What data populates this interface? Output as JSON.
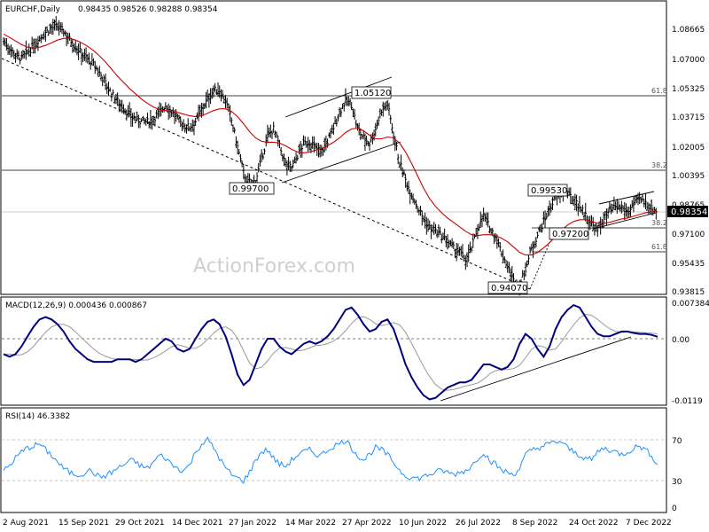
{
  "header": {
    "symbol_line": "EURCHF,Daily",
    "ohlc": "0.98435 0.98526 0.98288 0.98354"
  },
  "watermark": "ActionForex.com",
  "x_axis": {
    "labels": [
      "2 Aug 2021",
      "15 Sep 2021",
      "29 Oct 2021",
      "14 Dec 2021",
      "27 Jan 2022",
      "14 Mar 2022",
      "27 Apr 2022",
      "10 Jun 2022",
      "26 Jul 2022",
      "8 Sep 2022",
      "24 Oct 2022",
      "7 Dec 2022"
    ]
  },
  "price_panel": {
    "y_ticks": [
      "1.08665",
      "1.07000",
      "1.05325",
      "1.03715",
      "1.02005",
      "1.00395",
      "0.98765",
      "0.97100",
      "0.95435",
      "0.93815"
    ],
    "current_price_label": "0.98354",
    "fib_labels": [
      "61.8",
      "38.2",
      "38.2",
      "61.8"
    ],
    "annotations": [
      "1.05120",
      "0.99700",
      "0.99530",
      "0.97200",
      "0.94070"
    ]
  },
  "macd_panel": {
    "title": "MACD(12,26,9) 0.000436 0.000867",
    "y_ticks": [
      "0.007384",
      "0.00",
      "-0.0119"
    ]
  },
  "rsi_panel": {
    "title": "RSI(14) 46.3382",
    "y_ticks": [
      "70",
      "30",
      "0"
    ]
  },
  "colors": {
    "price_bars": "#000000",
    "moving_average": "#cc0000",
    "macd_line": "#000080",
    "signal_line": "#999999",
    "rsi_line": "#1e90ff",
    "current_price_bg": "#000000"
  },
  "chart_data": [
    {
      "type": "ohlc",
      "title": "EURCHF,Daily",
      "x_range": [
        "2 Aug 2021",
        "Dec 2022"
      ],
      "ylim": [
        0.93815,
        1.095
      ],
      "grid": false,
      "horizontal_levels": [
        1.0512,
        0.997,
        0.972,
        0.959
      ],
      "annotated_points": [
        {
          "label": "1.05120",
          "value": 1.0512,
          "date": "May 2022"
        },
        {
          "label": "0.99700",
          "value": 0.997,
          "date": "Mar 2022"
        },
        {
          "label": "0.99530",
          "value": 0.9953,
          "date": "Oct 2022"
        },
        {
          "label": "0.97200",
          "value": 0.972,
          "date": "Oct 2022"
        },
        {
          "label": "0.94070",
          "value": 0.9407,
          "date": "Sep 2022"
        }
      ],
      "close_series": [
        1.08,
        1.076,
        1.072,
        1.07,
        1.0735,
        1.0775,
        1.0815,
        1.085,
        1.0875,
        1.088,
        1.0855,
        1.081,
        1.077,
        1.073,
        1.07,
        1.0665,
        1.062,
        1.056,
        1.05,
        1.046,
        1.042,
        1.038,
        1.0355,
        1.0345,
        1.034,
        1.036,
        1.0395,
        1.0435,
        1.04,
        1.0355,
        1.032,
        1.031,
        1.0345,
        1.041,
        1.047,
        1.052,
        1.052,
        1.046,
        1.035,
        1.02,
        1.005,
        0.998,
        1.001,
        1.0125,
        1.026,
        1.03,
        1.02,
        1.01,
        1.008,
        1.015,
        1.0215,
        1.0225,
        1.019,
        1.0175,
        1.023,
        1.031,
        1.0395,
        1.046,
        1.044,
        1.03,
        1.025,
        1.022,
        1.03,
        1.041,
        1.044,
        1.027,
        1.011,
        1.001,
        0.993,
        0.986,
        0.979,
        0.974,
        0.972,
        0.969,
        0.966,
        0.962,
        0.96,
        0.956,
        0.962,
        0.974,
        0.981,
        0.974,
        0.969,
        0.96,
        0.952,
        0.944,
        0.941,
        0.951,
        0.962,
        0.97,
        0.977,
        0.985,
        0.991,
        0.994,
        0.993,
        0.99,
        0.986,
        0.981,
        0.976,
        0.972,
        0.979,
        0.983,
        0.9855,
        0.985,
        0.983,
        0.987,
        0.99,
        0.988,
        0.985,
        0.9835
      ],
      "moving_average_series": [
        1.084,
        1.082,
        1.08,
        1.078,
        1.0765,
        1.076,
        1.0765,
        1.0775,
        1.079,
        1.0805,
        1.0815,
        1.0815,
        1.0805,
        1.079,
        1.077,
        1.0745,
        1.0715,
        1.068,
        1.064,
        1.06,
        1.0565,
        1.053,
        1.05,
        1.047,
        1.0445,
        1.0425,
        1.041,
        1.0405,
        1.04,
        1.0395,
        1.0385,
        1.0375,
        1.037,
        1.0375,
        1.039,
        1.0405,
        1.0415,
        1.0415,
        1.04,
        1.037,
        1.033,
        1.0285,
        1.025,
        1.023,
        1.0225,
        1.0225,
        1.022,
        1.0205,
        1.0185,
        1.017,
        1.0165,
        1.017,
        1.018,
        1.019,
        1.0205,
        1.0225,
        1.025,
        1.028,
        1.03,
        1.0305,
        1.029,
        1.0265,
        1.0245,
        1.0245,
        1.0255,
        1.025,
        1.022,
        1.017,
        1.0105,
        1.0035,
        0.9965,
        0.9905,
        0.986,
        0.9825,
        0.9795,
        0.977,
        0.9745,
        0.972,
        0.97,
        0.9695,
        0.97,
        0.97,
        0.9695,
        0.968,
        0.966,
        0.963,
        0.96,
        0.9585,
        0.9585,
        0.96,
        0.9625,
        0.9655,
        0.969,
        0.9725,
        0.9755,
        0.9775,
        0.9785,
        0.9785,
        0.9775,
        0.9765,
        0.9765,
        0.977,
        0.978,
        0.979,
        0.9795,
        0.9805,
        0.9815,
        0.9825,
        0.983,
        0.983
      ]
    },
    {
      "type": "line",
      "title": "MACD(12,26,9) 0.000436 0.000867",
      "ylim": [
        -0.0125,
        0.008
      ],
      "series": [
        {
          "name": "MACD(12,26,9)",
          "values": [
            -0.003,
            -0.0035,
            -0.003,
            -0.0015,
            0.0005,
            0.0025,
            0.004,
            0.0045,
            0.004,
            0.003,
            0.0015,
            -0.0005,
            -0.002,
            -0.003,
            -0.004,
            -0.0045,
            -0.0045,
            -0.0045,
            -0.0045,
            -0.004,
            -0.004,
            -0.004,
            -0.0045,
            -0.004,
            -0.003,
            -0.002,
            -0.001,
            0.0,
            -0.0005,
            -0.002,
            -0.0025,
            -0.002,
            0.0,
            0.002,
            0.0035,
            0.004,
            0.003,
            0.0005,
            -0.003,
            -0.007,
            -0.009,
            -0.008,
            -0.005,
            -0.002,
            0.0,
            0.0,
            -0.0015,
            -0.0025,
            -0.003,
            -0.002,
            -0.001,
            -0.0005,
            -0.001,
            -0.0005,
            0.0005,
            0.002,
            0.004,
            0.006,
            0.0065,
            0.005,
            0.003,
            0.0015,
            0.002,
            0.0035,
            0.004,
            0.002,
            -0.0015,
            -0.005,
            -0.0075,
            -0.0095,
            -0.011,
            -0.0118,
            -0.0115,
            -0.0105,
            -0.0095,
            -0.009,
            -0.0085,
            -0.0085,
            -0.008,
            -0.0065,
            -0.005,
            -0.005,
            -0.0055,
            -0.006,
            -0.0055,
            -0.004,
            -0.001,
            0.001,
            0.0,
            -0.002,
            -0.0035,
            -0.0015,
            0.002,
            0.0045,
            0.006,
            0.007,
            0.0065,
            0.0045,
            0.0025,
            0.001,
            0.0005,
            0.0005,
            0.001,
            0.0015,
            0.0015,
            0.0012,
            0.001,
            0.001,
            0.0008,
            0.0004
          ]
        },
        {
          "name": "signal",
          "values": []
        }
      ]
    },
    {
      "type": "line",
      "title": "RSI(14) 46.3382",
      "ylim": [
        0,
        100
      ],
      "series": [
        {
          "name": "RSI(14)",
          "values": [
            40,
            45,
            52,
            58,
            62,
            64,
            66,
            60,
            55,
            48,
            42,
            38,
            36,
            36,
            40,
            38,
            33,
            35,
            38,
            42,
            45,
            50,
            48,
            44,
            42,
            48,
            55,
            52,
            46,
            42,
            40,
            45,
            58,
            66,
            70,
            62,
            52,
            42,
            36,
            32,
            30,
            38,
            50,
            58,
            60,
            52,
            46,
            44,
            50,
            55,
            58,
            60,
            56,
            55,
            60,
            64,
            66,
            70,
            62,
            55,
            50,
            56,
            62,
            60,
            55,
            48,
            40,
            35,
            33,
            32,
            34,
            36,
            38,
            40,
            38,
            36,
            38,
            40,
            44,
            52,
            58,
            50,
            46,
            40,
            38,
            36,
            42,
            55,
            60,
            62,
            64,
            66,
            68,
            68,
            62,
            58,
            55,
            52,
            50,
            58,
            62,
            60,
            58,
            56,
            58,
            62,
            64,
            60,
            55,
            46
          ]
        }
      ],
      "horizontal_levels": [
        70,
        30
      ]
    }
  ]
}
